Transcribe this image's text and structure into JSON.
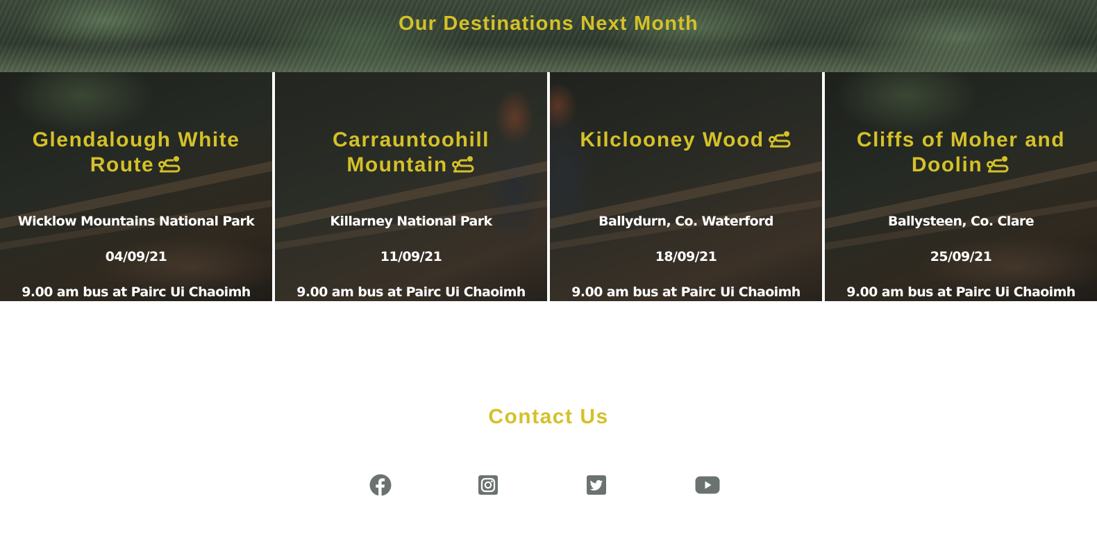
{
  "banner": {
    "title": "Our Destinations Next Month"
  },
  "destinations": [
    {
      "title": "Glendalough White Route",
      "location": "Wicklow Mountains National Park",
      "date": "04/09/21",
      "transport": "9.00 am bus at Pairc Ui Chaoimh"
    },
    {
      "title": "Carrauntoohill Mountain",
      "location": "Killarney National Park",
      "date": "11/09/21",
      "transport": "9.00 am bus at Pairc Ui Chaoimh"
    },
    {
      "title": "Kilclooney Wood",
      "location": "Ballydurn, Co. Waterford",
      "date": "18/09/21",
      "transport": "9.00 am bus at Pairc Ui Chaoimh"
    },
    {
      "title": "Cliffs of Moher and Doolin",
      "location": "Ballysteen, Co. Clare",
      "date": "25/09/21",
      "transport": "9.00 am bus at Pairc Ui Chaoimh"
    }
  ],
  "contact": {
    "title": "Contact Us",
    "social": [
      {
        "icon": "facebook-icon"
      },
      {
        "icon": "instagram-icon"
      },
      {
        "icon": "twitter-icon"
      },
      {
        "icon": "youtube-icon"
      }
    ]
  },
  "colors": {
    "accent": "#d4c129",
    "icon": "#6b7370"
  }
}
